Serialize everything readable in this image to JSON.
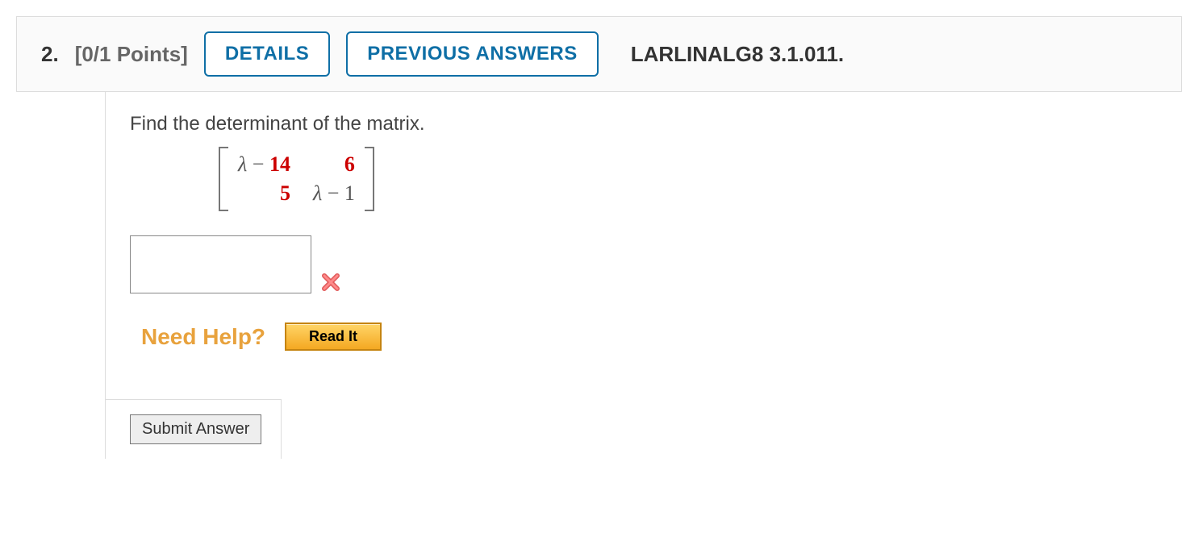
{
  "header": {
    "number": "2.",
    "points": "[0/1 Points]",
    "details_label": "DETAILS",
    "previous_label": "PREVIOUS ANSWERS",
    "assignment_id": "LARLINALG8 3.1.011."
  },
  "question": {
    "prompt": "Find the determinant of the matrix.",
    "matrix": {
      "r1c1_var": "λ",
      "r1c1_op": " − ",
      "r1c1_num": "14",
      "r1c2_num": "6",
      "r2c1_num": "5",
      "r2c2_var": "λ",
      "r2c2_op": " − ",
      "r2c2_num": "1"
    },
    "answer_value": "",
    "status": "incorrect"
  },
  "help": {
    "label": "Need Help?",
    "read_label": "Read It"
  },
  "actions": {
    "submit_label": "Submit Answer"
  }
}
